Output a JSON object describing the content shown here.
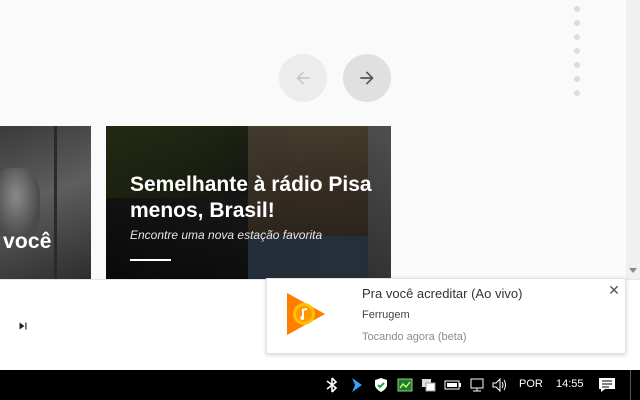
{
  "hero_card": {
    "title": "Semelhante à rádio Pisa menos, Brasil!",
    "subtitle": "Encontre uma nova estação favorita"
  },
  "left_card": {
    "label": "você"
  },
  "notification": {
    "title": "Pra você acreditar (Ao vivo)",
    "artist": "Ferrugem",
    "status": "Tocando agora (beta)",
    "close_glyph": "✕",
    "app_icon": "google-play-music-icon"
  },
  "taskbar": {
    "language": "POR",
    "time": "14:55",
    "tray_icons": [
      "bluetooth-icon",
      "media-arrow-icon",
      "security-shield-icon",
      "monitor-app-icon",
      "copy-windows-icon",
      "battery-icon",
      "network-icon",
      "volume-icon",
      "action-center-icon"
    ]
  },
  "colors": {
    "accent_orange": "#ff7a00",
    "accent_yellow": "#ffc107",
    "background": "#fafafa",
    "taskbar": "#000000"
  }
}
